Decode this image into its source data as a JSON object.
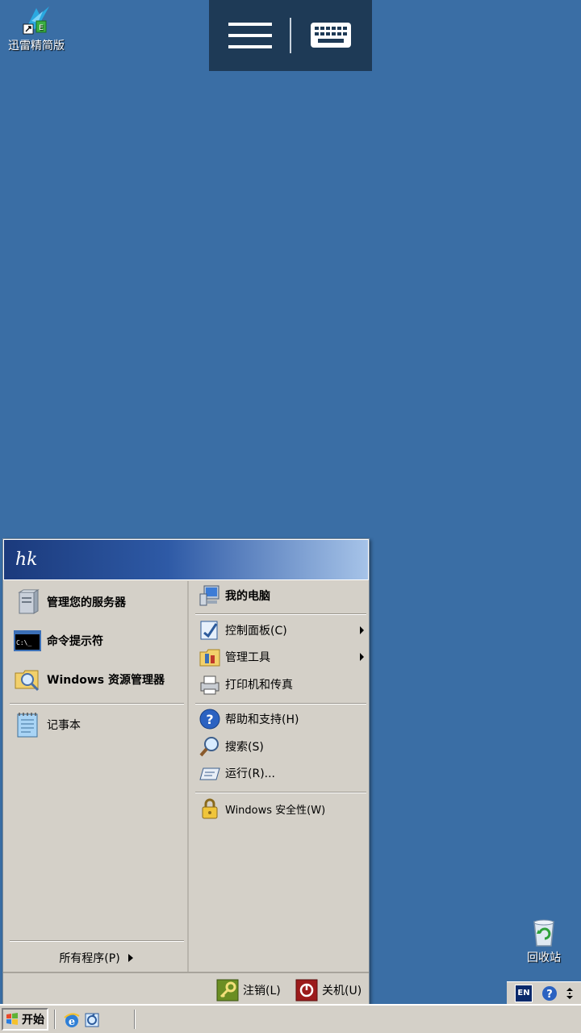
{
  "desktop": {
    "icons": [
      {
        "label": "迅雷精简版",
        "icon": "xunlei-shortcut-icon"
      },
      {
        "label": "回收站",
        "icon": "recycle-bin-icon"
      }
    ]
  },
  "remote_toolbar": {
    "menu_icon": "hamburger-menu-icon",
    "keyboard_icon": "keyboard-icon"
  },
  "start_menu": {
    "user_name": "hk",
    "left_items": [
      {
        "label": "管理您的服务器",
        "icon": "server-manage-icon"
      },
      {
        "label": "命令提示符",
        "icon": "command-prompt-icon"
      },
      {
        "label": "Windows 资源管理器",
        "icon": "explorer-icon"
      },
      {
        "label": "记事本",
        "icon": "notepad-icon"
      }
    ],
    "all_programs": "所有程序(P)",
    "right_items": [
      {
        "label": "我的电脑",
        "icon": "my-computer-icon"
      },
      {
        "label": "控制面板(C)",
        "icon": "control-panel-icon"
      },
      {
        "label": "管理工具",
        "icon": "admin-tools-icon"
      },
      {
        "label": "打印机和传真",
        "icon": "printer-icon"
      },
      {
        "label": "帮助和支持(H)",
        "icon": "help-icon"
      },
      {
        "label": "搜索(S)",
        "icon": "search-icon"
      },
      {
        "label": "运行(R)...",
        "icon": "run-icon"
      },
      {
        "label": "Windows 安全性(W)",
        "icon": "security-lock-icon"
      }
    ],
    "footer": {
      "logoff": "注销(L)",
      "shutdown": "关机(U)"
    }
  },
  "taskbar": {
    "start_label": "开始",
    "tray": {
      "language": "EN"
    }
  },
  "colors": {
    "desktop": "#3a6ea5",
    "menu_header_dark": "#1b3a7c",
    "menu_body": "#d4d0c8"
  }
}
